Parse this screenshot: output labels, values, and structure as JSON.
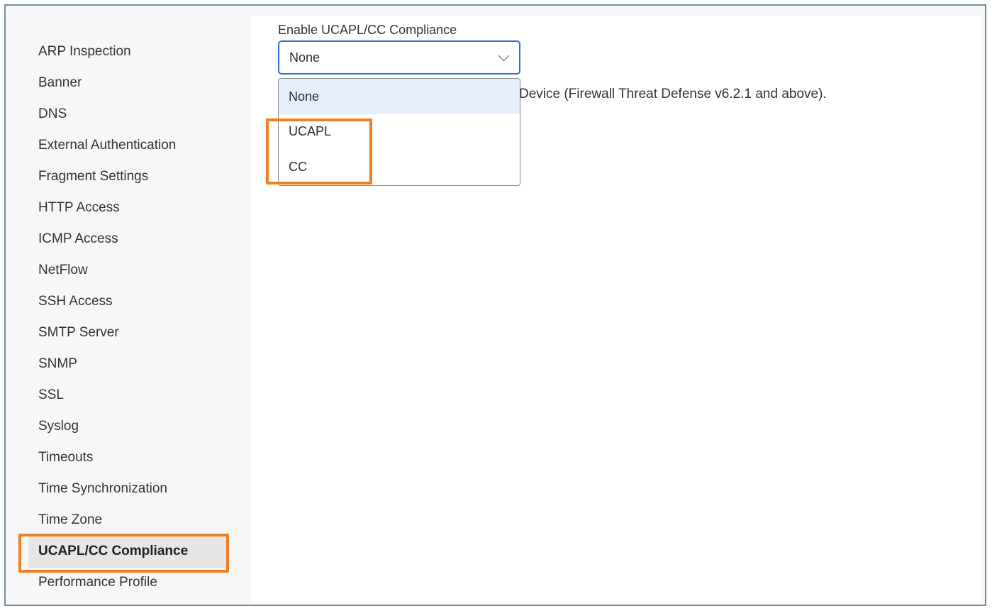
{
  "sidebar": {
    "items": [
      {
        "label": "ARP Inspection"
      },
      {
        "label": "Banner"
      },
      {
        "label": "DNS"
      },
      {
        "label": "External Authentication"
      },
      {
        "label": "Fragment Settings"
      },
      {
        "label": "HTTP Access"
      },
      {
        "label": "ICMP Access"
      },
      {
        "label": "NetFlow"
      },
      {
        "label": "SSH Access"
      },
      {
        "label": "SMTP Server"
      },
      {
        "label": "SNMP"
      },
      {
        "label": "SSL"
      },
      {
        "label": "Syslog"
      },
      {
        "label": "Timeouts"
      },
      {
        "label": "Time Synchronization"
      },
      {
        "label": "Time Zone"
      },
      {
        "label": "UCAPL/CC Compliance",
        "active": true
      },
      {
        "label": "Performance Profile"
      }
    ]
  },
  "main": {
    "field_label": "Enable UCAPL/CC Compliance",
    "select_value": "None",
    "options": [
      "None",
      "UCAPL",
      "CC"
    ],
    "selected_option": "None",
    "description_visible": "Device (Firewall Threat Defense v6.2.1 and above)."
  },
  "colors": {
    "highlight": "#f07f22",
    "focus_border": "#2f6fd1",
    "selected_option_bg": "#e5eefb"
  }
}
